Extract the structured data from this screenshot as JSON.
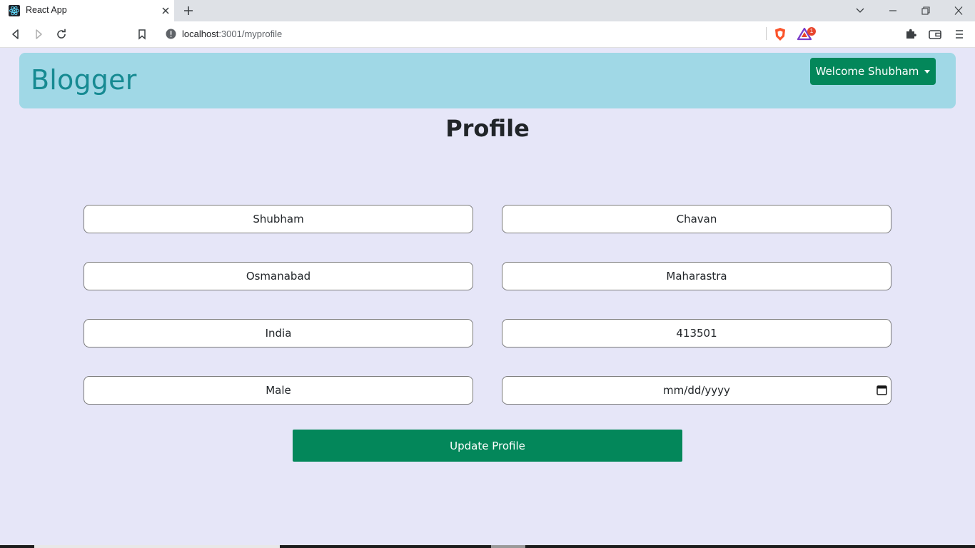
{
  "browser": {
    "tab_title": "React App",
    "url_host": "localhost",
    "url_path": ":3001/myprofile",
    "extension_badge": "1"
  },
  "navbar": {
    "brand": "Blogger",
    "welcome_label": "Welcome Shubham"
  },
  "profile": {
    "title": "Profile",
    "fields": {
      "first_name": "Shubham",
      "last_name": "Chavan",
      "city": "Osmanabad",
      "state": "Maharastra",
      "country": "India",
      "pincode": "413501",
      "gender": "Male",
      "dob_placeholder": "mm/dd/yyyy"
    },
    "update_label": "Update Profile"
  },
  "colors": {
    "accent_green": "#03875a",
    "navbar_bg": "#a0d8e6",
    "brand_text": "#168a92",
    "page_bg": "#e6e6f8"
  },
  "icons": [
    "react-favicon-icon",
    "close-icon",
    "plus-icon",
    "chevron-down-icon",
    "minimize-icon",
    "restore-icon",
    "close-window-icon",
    "back-icon",
    "forward-icon",
    "reload-icon",
    "bookmark-icon",
    "info-icon",
    "brave-shield-icon",
    "brave-rewards-icon",
    "puzzle-icon",
    "wallet-icon",
    "menu-icon",
    "calendar-icon"
  ]
}
